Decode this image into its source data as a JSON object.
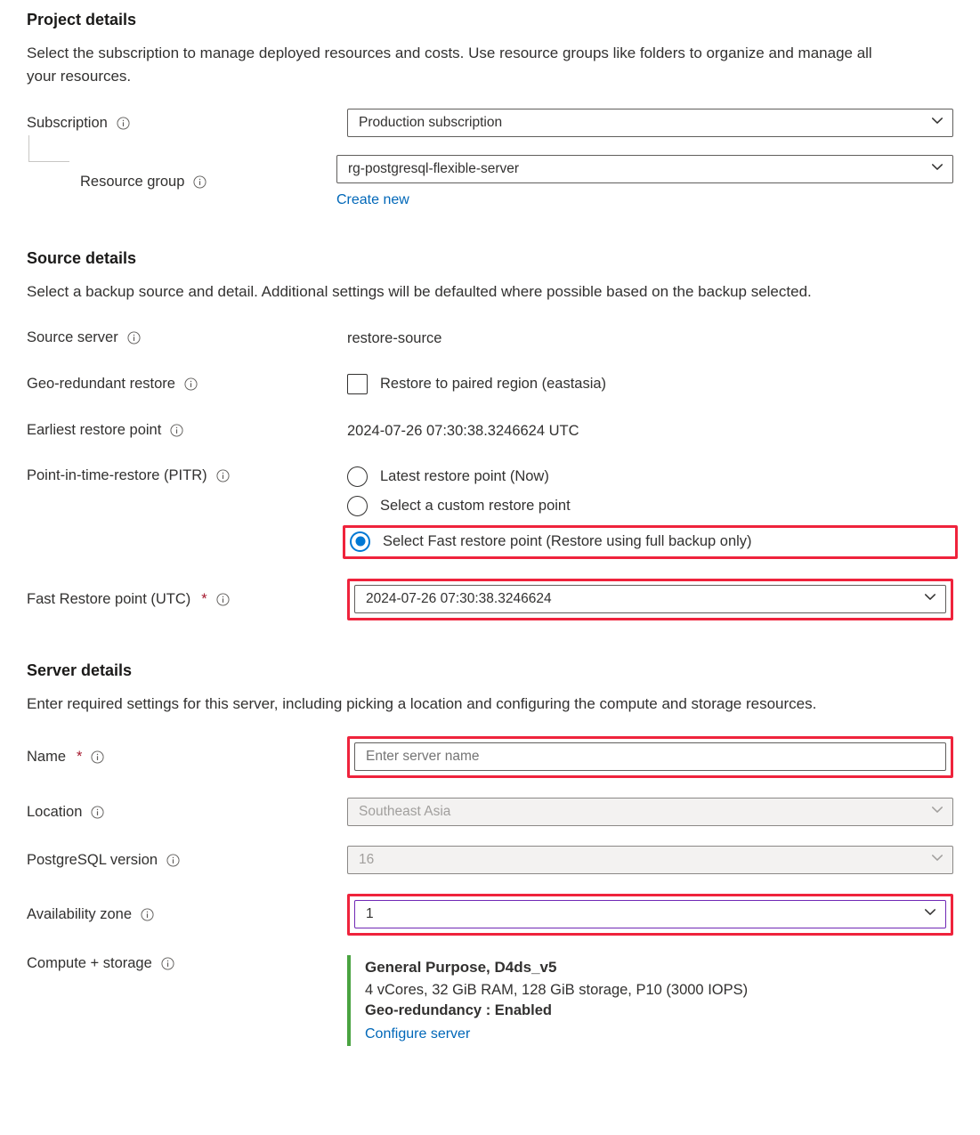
{
  "project": {
    "heading": "Project details",
    "description": "Select the subscription to manage deployed resources and costs. Use resource groups like folders to organize and manage all your resources.",
    "subscription_label": "Subscription",
    "subscription_value": "Production subscription",
    "resource_group_label": "Resource group",
    "resource_group_value": "rg-postgresql-flexible-server",
    "create_new_label": "Create new"
  },
  "source": {
    "heading": "Source details",
    "description": "Select a backup source and detail. Additional settings will be defaulted where possible based on the backup selected.",
    "source_server_label": "Source server",
    "source_server_value": "restore-source",
    "geo_restore_label": "Geo-redundant restore",
    "geo_restore_checkbox_label": "Restore to paired region (eastasia)",
    "earliest_label": "Earliest restore point",
    "earliest_value": "2024-07-26 07:30:38.3246624 UTC",
    "pitr_label": "Point-in-time-restore (PITR)",
    "pitr_options": {
      "latest": "Latest restore point (Now)",
      "custom": "Select a custom restore point",
      "fast": "Select Fast restore point (Restore using full backup only)"
    },
    "fast_point_label": "Fast Restore point (UTC)",
    "fast_point_value": "2024-07-26 07:30:38.3246624"
  },
  "server": {
    "heading": "Server details",
    "description": "Enter required settings for this server, including picking a location and configuring the compute and storage resources.",
    "name_label": "Name",
    "name_placeholder": "Enter server name",
    "name_value": "",
    "location_label": "Location",
    "location_value": "Southeast Asia",
    "pg_version_label": "PostgreSQL version",
    "pg_version_value": "16",
    "az_label": "Availability zone",
    "az_value": "1",
    "compute_label": "Compute + storage",
    "compute": {
      "title": "General Purpose, D4ds_v5",
      "spec": "4 vCores, 32 GiB RAM, 128 GiB storage, P10 (3000 IOPS)",
      "geo": "Geo-redundancy : Enabled",
      "configure_link": "Configure server"
    }
  }
}
